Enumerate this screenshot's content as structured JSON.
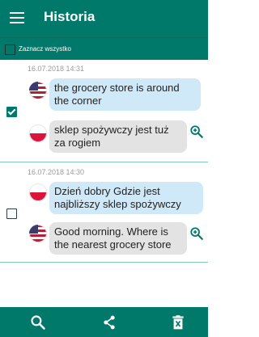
{
  "appbar": {
    "title": "Historia",
    "menu_icon": "menu-icon"
  },
  "select_all": {
    "label": "Zaznacz wszystko",
    "checked": false
  },
  "colors": {
    "primary": "#00796b",
    "bubble_source": "#cfe9f8",
    "bubble_translation": "#e3e3e3",
    "divider": "#7fc9c0"
  },
  "entries": [
    {
      "timestamp": "16.07.2018 14:31",
      "checked": true,
      "source": {
        "flag": "us-flag-icon",
        "text": "the grocery store is around the corner"
      },
      "translation": {
        "flag": "pl-flag-icon",
        "text": "sklep spożywczy jest tuż za rogiem",
        "action_icon": "zoom-in-icon"
      }
    },
    {
      "timestamp": "16.07.2018 14:30",
      "checked": false,
      "source": {
        "flag": "pl-flag-icon",
        "text": "Dzień dobry Gdzie jest najbliższy sklep spożywczy"
      },
      "translation": {
        "flag": "us-flag-icon",
        "text": "Good morning. Where is the nearest grocery store",
        "action_icon": "zoom-in-icon"
      }
    }
  ],
  "bottom_bar": {
    "icons": [
      "search-icon",
      "share-icon",
      "delete-icon"
    ]
  }
}
